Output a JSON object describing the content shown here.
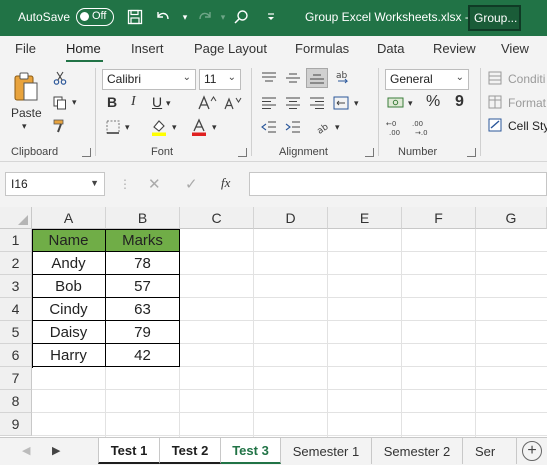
{
  "titlebar": {
    "autosave_label": "AutoSave",
    "autosave_state": "Off",
    "filename": "Group Excel Worksheets.xlsx  -",
    "group_label": "Group..."
  },
  "ribbon_tabs": [
    "File",
    "Home",
    "Insert",
    "Page Layout",
    "Formulas",
    "Data",
    "Review",
    "View"
  ],
  "active_tab": "Home",
  "ribbon": {
    "clipboard": {
      "label": "Clipboard",
      "paste_label": "Paste"
    },
    "font": {
      "label": "Font",
      "font_name": "Calibri",
      "font_size": "11",
      "bold": "B",
      "italic": "I",
      "underline": "U"
    },
    "alignment": {
      "label": "Alignment"
    },
    "number": {
      "label": "Number",
      "format": "General",
      "percent": "%",
      "comma": "9"
    },
    "styles": {
      "conditional": "Conditi",
      "format_as": "Format",
      "cell_styles": "Cell Sty"
    }
  },
  "formula_bar": {
    "name_box": "I16",
    "fx": "fx",
    "formula": ""
  },
  "columns": [
    "A",
    "B",
    "C",
    "D",
    "E",
    "F",
    "G"
  ],
  "rows": [
    "1",
    "2",
    "3",
    "4",
    "5",
    "6",
    "7",
    "8",
    "9"
  ],
  "table": {
    "headers": [
      "Name",
      "Marks"
    ],
    "rows": [
      [
        "Andy",
        "78"
      ],
      [
        "Bob",
        "57"
      ],
      [
        "Cindy",
        "63"
      ],
      [
        "Daisy",
        "79"
      ],
      [
        "Harry",
        "42"
      ]
    ],
    "header_color": "#70ad47"
  },
  "sheets": [
    "Test 1",
    "Test 2",
    "Test 3",
    "Semester 1",
    "Semester 2",
    "Ser"
  ],
  "accent_color": "#217346"
}
